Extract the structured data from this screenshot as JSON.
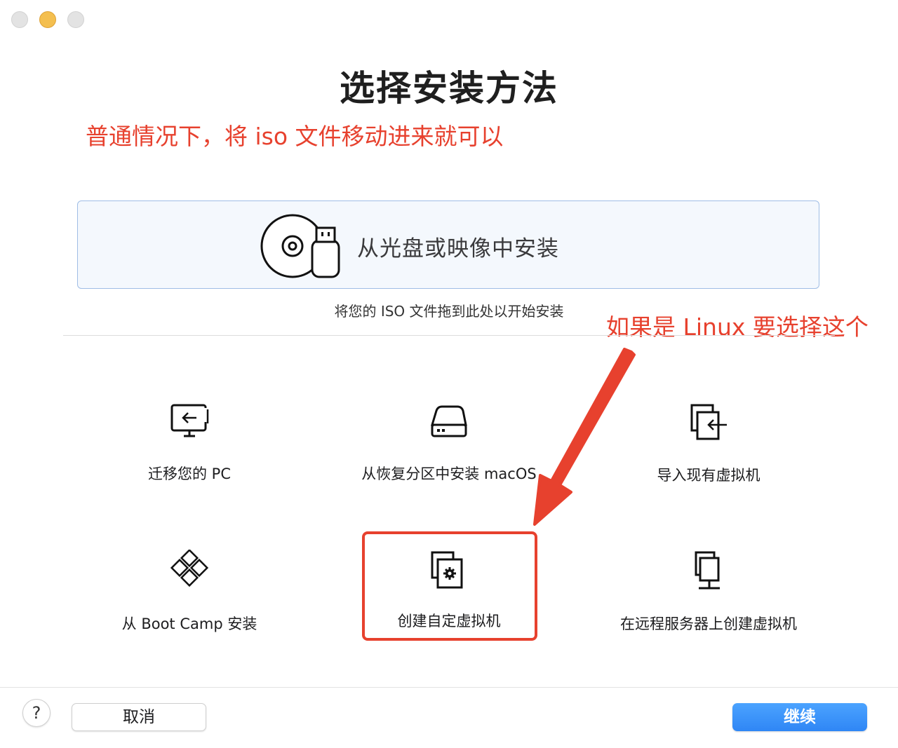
{
  "window": {
    "title": "选择安装方法",
    "traffic_lights": [
      "close",
      "minimize",
      "zoom"
    ]
  },
  "annotations": {
    "top_note": "普通情况下，将 iso 文件移动进来就可以",
    "linux_note": "如果是 Linux 要选择这个",
    "color": "#e7412e"
  },
  "drop_zone": {
    "label": "从光盘或映像中安装",
    "hint": "将您的 ISO 文件拖到此处以开始安装",
    "icon": "disc-usb-icon"
  },
  "options": [
    {
      "label": "迁移您的 PC",
      "icon": "migrate-pc-icon"
    },
    {
      "label": "从恢复分区中安装 macOS",
      "icon": "hard-drive-icon"
    },
    {
      "label": "导入现有虚拟机",
      "icon": "import-vm-icon"
    },
    {
      "label": "从 Boot Camp 安装",
      "icon": "boot-camp-icon"
    },
    {
      "label": "创建自定虚拟机",
      "icon": "custom-vm-icon"
    },
    {
      "label": "在远程服务器上创建虚拟机",
      "icon": "remote-server-icon"
    }
  ],
  "footer": {
    "help_label": "?",
    "cancel_label": "取消",
    "continue_label": "继续",
    "accent_color": "#2f86f5"
  }
}
